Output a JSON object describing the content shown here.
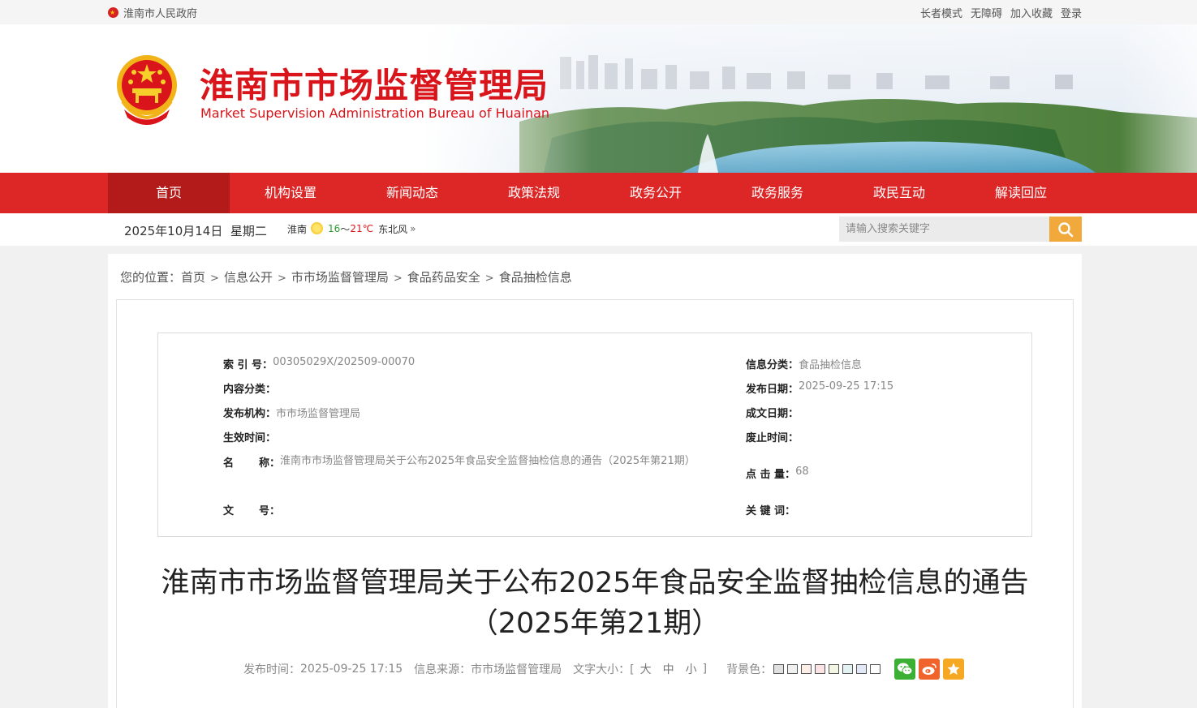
{
  "topbar": {
    "gov_link": "淮南市人民政府",
    "links": [
      "长者模式",
      "无障碍",
      "加入收藏",
      "登录"
    ]
  },
  "header": {
    "title": "淮南市市场监督管理局",
    "subtitle": "Market Supervision Administration Bureau of Huainan"
  },
  "nav": {
    "items": [
      "首页",
      "机构设置",
      "新闻动态",
      "政策法规",
      "政务公开",
      "政务服务",
      "政民互动",
      "解读回应"
    ],
    "active_index": 0
  },
  "infobar": {
    "date": "2025年10月14日",
    "weekday": "星期二",
    "weather_city": "淮南",
    "temp_low": "16",
    "temp_sep": "～",
    "temp_high": "21℃",
    "wind": "东北风",
    "more": "»",
    "search_placeholder": "请输入搜索关键字"
  },
  "breadcrumb": {
    "prefix": "您的位置：",
    "items": [
      "首页",
      "信息公开",
      "市市场监督管理局",
      "食品药品安全",
      "食品抽检信息"
    ],
    "separator": ">"
  },
  "meta": {
    "index_label": "索 引 号：",
    "index_value": "00305029X/202509-00070",
    "category_label": "信息分类：",
    "category_value": "食品抽检信息",
    "content_label": "内容分类：",
    "content_value": "",
    "pubdate_label": "发布日期：",
    "pubdate_value": "2025-09-25 17:15",
    "org_label": "发布机构：",
    "org_value": "市市场监督管理局",
    "written_label": "成文日期：",
    "written_value": "",
    "effective_label": "生效时间：",
    "effective_value": "",
    "expire_label": "废止时间：",
    "expire_value": "",
    "name_label_a": "名",
    "name_label_b": "称：",
    "name_value": "淮南市市场监督管理局关于公布2025年食品安全监督抽检信息的通告（2025年第21期）",
    "clicks_label": "点 击 量：",
    "clicks_value": "68",
    "docno_label_a": "文",
    "docno_label_b": "号：",
    "docno_value": "",
    "keywords_label": "关 键 词：",
    "keywords_value": ""
  },
  "article": {
    "title": "淮南市市场监督管理局关于公布2025年食品安全监督抽检信息的通告（2025年第21期）",
    "pub_label": "发布时间：",
    "pub_value": "2025-09-25 17:15",
    "source_label": "信息来源：",
    "source_value": "市市场监督管理局",
    "fontsize_label": "文字大小：[",
    "fontsize_options": [
      "大",
      "中",
      "小"
    ],
    "fontsize_end": "]",
    "bg_label": "背景色：",
    "bg_colors": [
      "#e0e0e0",
      "#f0f0f0",
      "#fdeee8",
      "#fbe3e3",
      "#f2f6e3",
      "#e3f3f3",
      "#e3e8f6",
      "#ffffff"
    ],
    "share_icons": [
      "wechat-icon",
      "weibo-icon",
      "favorite-icon"
    ],
    "share_colors": [
      "#3cb034",
      "#f0632b",
      "#f7a823"
    ]
  }
}
